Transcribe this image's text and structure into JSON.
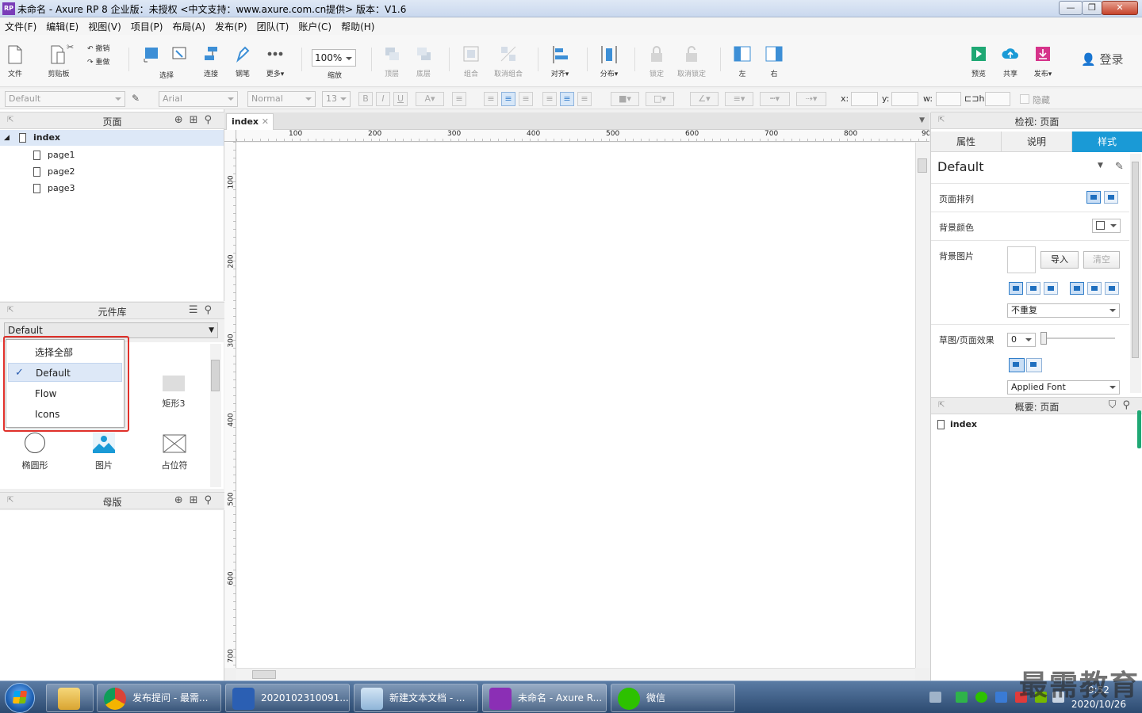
{
  "window": {
    "title": "未命名 - Axure RP 8 企业版：未授权     <中文支持：www.axure.com.cn提供> 版本：V1.6",
    "app_icon": "RP"
  },
  "menu": [
    "文件(F)",
    "编辑(E)",
    "视图(V)",
    "项目(P)",
    "布局(A)",
    "发布(P)",
    "团队(T)",
    "账户(C)",
    "帮助(H)"
  ],
  "toolbar": {
    "file": "文件",
    "clipboard": "剪贴板",
    "undo": "撤销",
    "redo": "重做",
    "select": "选择",
    "connect": "连接",
    "pen": "钢笔",
    "more": "更多▾",
    "zoom_value": "100%",
    "zoom": "缩放",
    "top": "顶层",
    "bottom": "底层",
    "group": "组合",
    "ungroup": "取消组合",
    "align": "对齐▾",
    "distribute": "分布▾",
    "lock": "锁定",
    "unlock": "取消锁定",
    "left": "左",
    "right": "右",
    "preview": "预览",
    "share": "共享",
    "publish": "发布▾",
    "login": "登录"
  },
  "format": {
    "style": "Default",
    "font": "Arial",
    "weight": "Normal",
    "size": "13",
    "x_label": "x:",
    "y_label": "y:",
    "w_label": "w:",
    "h_label": "h:",
    "hidden": "隐藏"
  },
  "pages_panel": {
    "title": "页面",
    "root": "index",
    "children": [
      "page1",
      "page2",
      "page3"
    ]
  },
  "library_panel": {
    "title": "元件库",
    "selected": "Default",
    "dropdown": [
      "选择全部",
      "Default",
      "Flow",
      "Icons"
    ],
    "widgets": [
      "矩形3",
      "椭圆形",
      "图片",
      "占位符"
    ]
  },
  "masters_panel": {
    "title": "母版"
  },
  "canvas": {
    "tab": "index",
    "ruler_top": [
      "100",
      "200",
      "300",
      "400",
      "500",
      "600",
      "700",
      "800",
      "90"
    ],
    "ruler_left": [
      "100",
      "200",
      "300",
      "400",
      "500",
      "600",
      "700"
    ]
  },
  "inspector": {
    "title": "检视: 页面",
    "tabs": [
      "属性",
      "说明",
      "样式"
    ],
    "active_tab": "样式",
    "style_name": "Default",
    "page_align": "页面排列",
    "bg_color": "背景颜色",
    "bg_image": "背景图片",
    "import": "导入",
    "clear": "清空",
    "repeat": "不重复",
    "sketch": "草图/页面效果",
    "sketch_value": "0",
    "font": "Applied Font"
  },
  "outline": {
    "title": "概要: 页面",
    "item": "index"
  },
  "taskbar": {
    "tasks": [
      "发布提问 - 最需...",
      "2020102310091...",
      "新建文本文档 - ...",
      "未命名 - Axure R...",
      "微信"
    ],
    "time": "9:52",
    "date": "2020/10/26"
  },
  "watermark": "最需教育",
  "colors": {
    "accent": "#1a9ad6",
    "highlight": "#e0302a",
    "taskbar": "#2c4a70"
  }
}
